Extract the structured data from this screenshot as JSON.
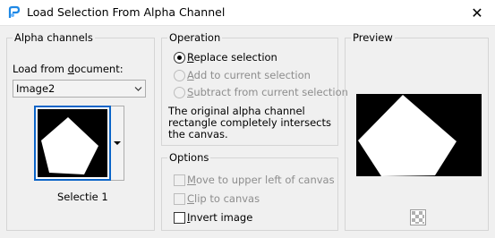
{
  "window": {
    "title": "Load Selection From Alpha Channel",
    "close_glyph": "✕"
  },
  "alpha_channels": {
    "title": "Alpha channels",
    "load_from_label": "Load from document:",
    "document_value": "Image2",
    "channel_name": "Selectie 1"
  },
  "operation": {
    "title": "Operation",
    "options": [
      {
        "label": "Replace selection",
        "selected": true,
        "enabled": true
      },
      {
        "label": "Add to current selection",
        "selected": false,
        "enabled": false
      },
      {
        "label": "Subtract from current selection",
        "selected": false,
        "enabled": false
      }
    ],
    "info_text": "The original alpha channel rectangle completely intersects the canvas."
  },
  "options": {
    "title": "Options",
    "items": [
      {
        "label": "Move to upper left of canvas",
        "checked": false,
        "enabled": false
      },
      {
        "label": "Clip to canvas",
        "checked": false,
        "enabled": false
      },
      {
        "label": "Invert image",
        "checked": false,
        "enabled": true
      }
    ]
  },
  "preview": {
    "title": "Preview"
  },
  "icons": {
    "app": "app-logo-icon",
    "close": "close-icon",
    "dropdown": "chevron-down-icon",
    "checker": "checkerboard-icon"
  },
  "colors": {
    "accent": "#0a64c8",
    "app_icon_blue": "#1e88e5"
  }
}
